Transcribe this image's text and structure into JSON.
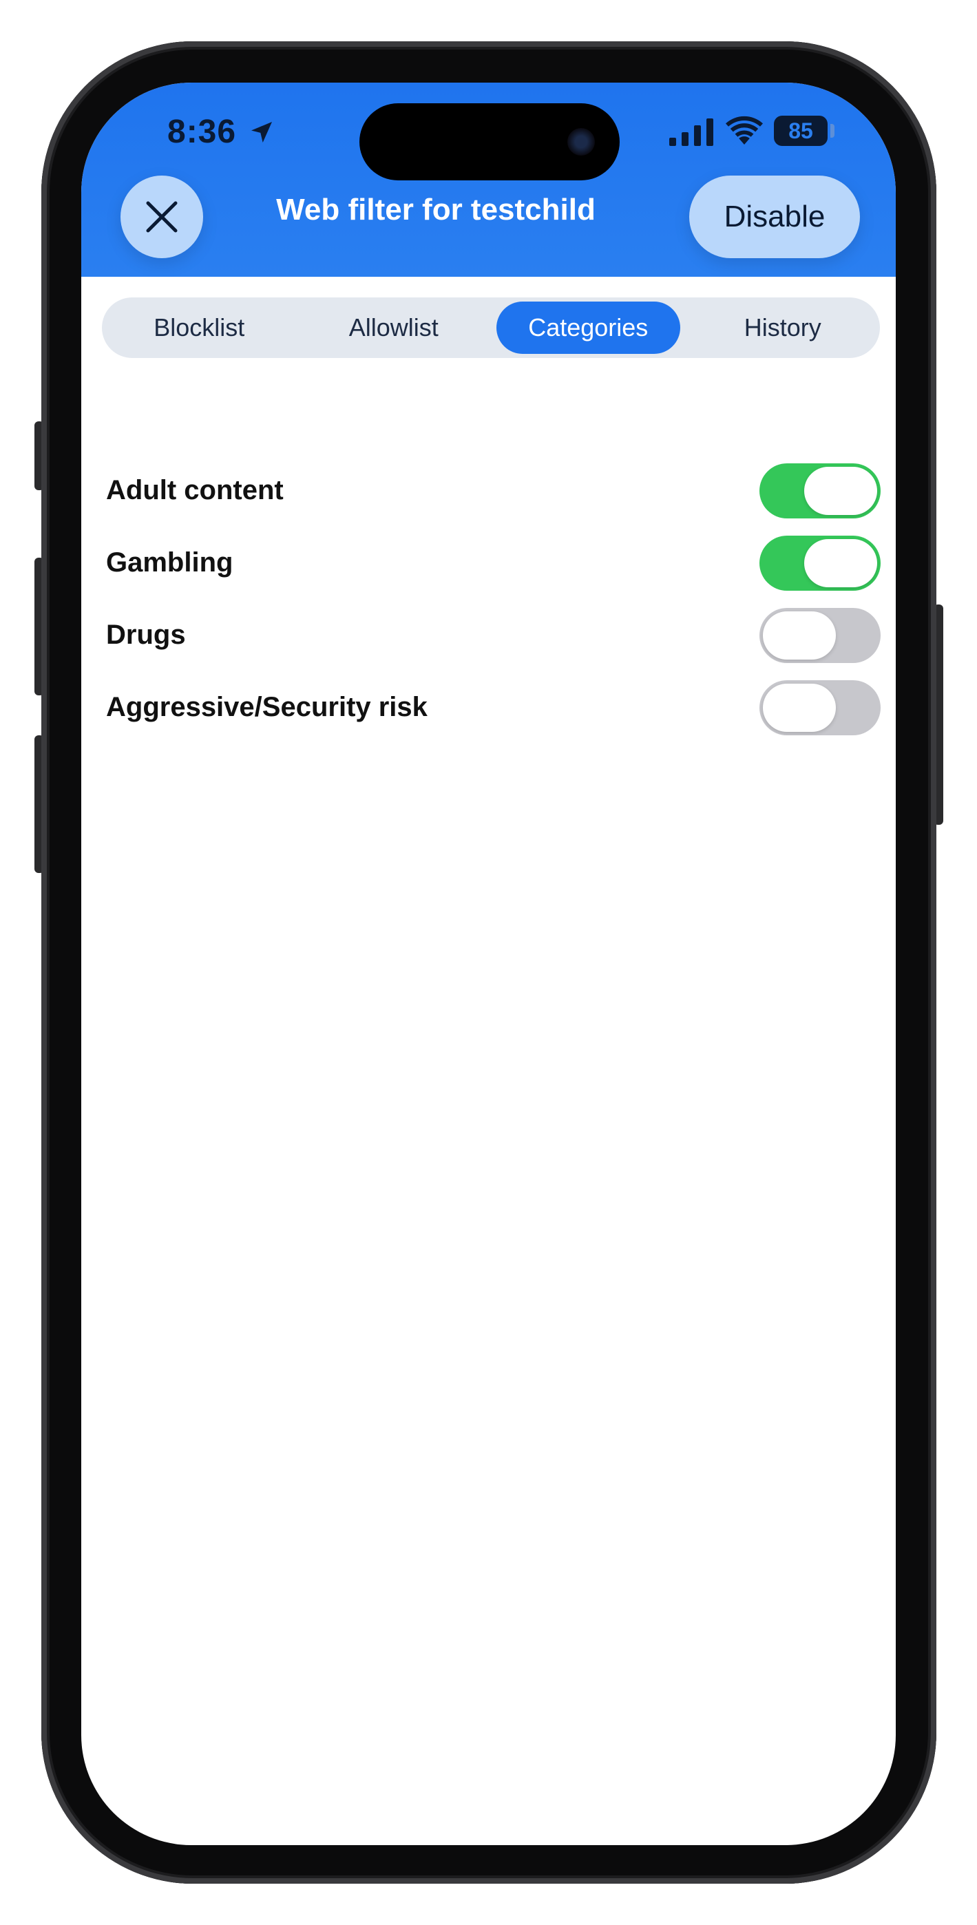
{
  "status_bar": {
    "time": "8:36",
    "battery": "85"
  },
  "header": {
    "title": "Web filter for testchild",
    "disable_label": "Disable",
    "accent_color": "#1f74ee"
  },
  "tabs": [
    {
      "label": "Blocklist",
      "active": false
    },
    {
      "label": "Allowlist",
      "active": false
    },
    {
      "label": "Categories",
      "active": true
    },
    {
      "label": "History",
      "active": false
    }
  ],
  "categories": [
    {
      "label": "Adult content",
      "enabled": true
    },
    {
      "label": "Gambling",
      "enabled": true
    },
    {
      "label": "Drugs",
      "enabled": false
    },
    {
      "label": "Aggressive/Security risk",
      "enabled": false
    }
  ],
  "colors": {
    "toggle_on": "#34c759",
    "toggle_off": "#c7c7cc"
  }
}
